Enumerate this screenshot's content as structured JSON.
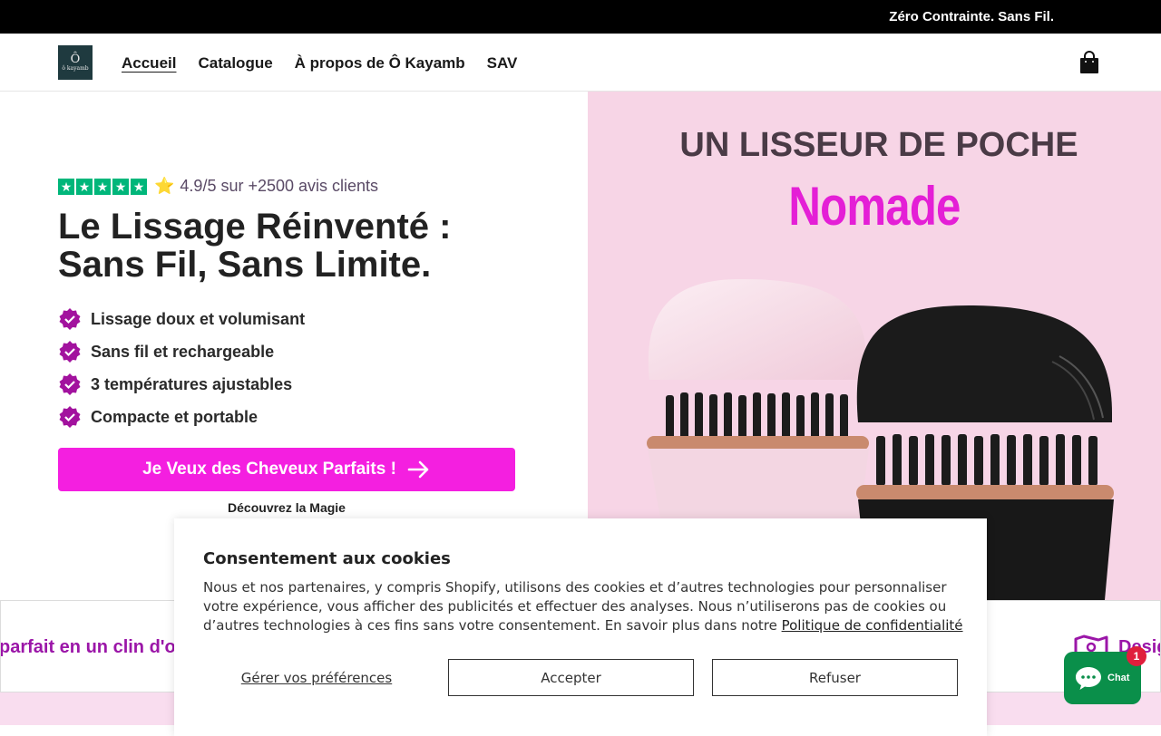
{
  "announcement": {
    "text": "Zéro Contrainte. Sans Fil."
  },
  "header": {
    "logo": {
      "symbol": "Ô",
      "text": "ô kayamb"
    },
    "nav": [
      {
        "label": "Accueil",
        "active": true
      },
      {
        "label": "Catalogue",
        "active": false
      },
      {
        "label": "À propos de Ô Kayamb",
        "active": false
      },
      {
        "label": "SAV",
        "active": false
      }
    ],
    "cart_icon": "shopping-bag-icon"
  },
  "hero": {
    "rating": {
      "stars": 5,
      "text": "4.9/5 sur +2500 avis clients"
    },
    "headline_line1": "Le Lissage Réinventé :",
    "headline_line2": "Sans Fil, Sans Limite.",
    "bullets": [
      "Lissage doux et volumisant",
      "Sans fil et rechargeable",
      "3 températures ajustables",
      "Compacte et portable"
    ],
    "cta_label": "Je Veux des Cheveux Parfaits !",
    "discover_label": "Découvrez la Magie",
    "image": {
      "title": "UN LISSEUR DE POCHE",
      "subtitle": "Nomade"
    }
  },
  "marquee": {
    "left_text": "parfait en un clin d'o",
    "right_text": "Desig"
  },
  "cookie_banner": {
    "title": "Consentement aux cookies",
    "body": "Nous et nos partenaires, y compris Shopify, utilisons des cookies et d’autres technologies pour personnaliser votre expérience, vous afficher des publicités et effectuer des analyses. Nous n’utiliserons pas de cookies ou d’autres technologies à ces fins sans votre consentement. En savoir plus dans notre ",
    "privacy_link": "Politique de confidentialité",
    "preferences_label": "Gérer vos préférences",
    "accept_label": "Accepter",
    "refuse_label": "Refuser"
  },
  "chat": {
    "label": "Chat",
    "badge": "1"
  },
  "colors": {
    "brand_pink": "#f41fe0",
    "purple": "#9b16a8",
    "trustpilot_green": "#00b67a",
    "hero_bg": "#f7d5e6"
  }
}
